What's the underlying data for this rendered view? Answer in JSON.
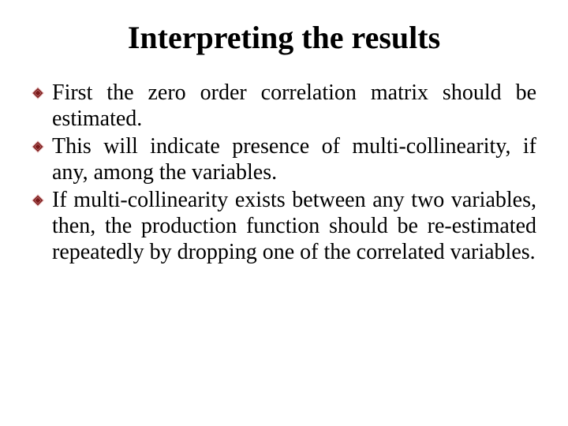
{
  "title": "Interpreting the results",
  "bullets": [
    "First the zero order correlation matrix should be estimated.",
    "This will indicate presence of multi-collinearity, if any, among the variables.",
    "If multi-collinearity exists between any two variables, then, the production function should be re-estimated repeatedly by dropping one of the correlated variables."
  ],
  "colors": {
    "bullet_fill": "#7a1818",
    "bullet_stroke": "#e0b0b0"
  }
}
